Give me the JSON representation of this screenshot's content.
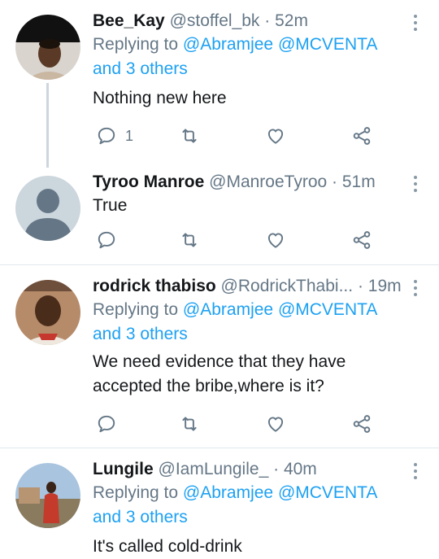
{
  "tweets": [
    {
      "name": "Bee_Kay",
      "handle": "@stoffel_bk",
      "time": "52m",
      "replying_prefix": "Replying to",
      "mention1": "@Abramjee",
      "mention2": "@MCVENTA",
      "and_others": "and 3 others",
      "text": "Nothing new here",
      "reply_count": "1",
      "avatar": "photo"
    },
    {
      "name": "Tyroo Manroe",
      "handle": "@ManroeTyroo",
      "time": "51m",
      "text": "True",
      "avatar": "default-profile"
    },
    {
      "name": "rodrick thabiso",
      "handle": "@RodrickThabi...",
      "time": "19m",
      "replying_prefix": "Replying to",
      "mention1": "@Abramjee",
      "mention2": "@MCVENTA",
      "and_others": "and 3 others",
      "text_line1": "We need evidence that they have",
      "text_line2": "accepted the bribe,where is it?",
      "avatar": "photo"
    },
    {
      "name": "Lungile",
      "handle": "@IamLungile_",
      "time": "40m",
      "replying_prefix": "Replying to",
      "mention1": "@Abramjee",
      "mention2": "@MCVENTA",
      "and_others": "and 3 others",
      "text": "It's called cold-drink",
      "avatar": "photo"
    }
  ],
  "separator": "·",
  "colors": {
    "link": "#1da1f2",
    "muted": "#657786",
    "divider": "#e1e8ed"
  },
  "icons": [
    "reply-icon",
    "retweet-icon",
    "like-icon",
    "share-icon",
    "more-icon"
  ]
}
